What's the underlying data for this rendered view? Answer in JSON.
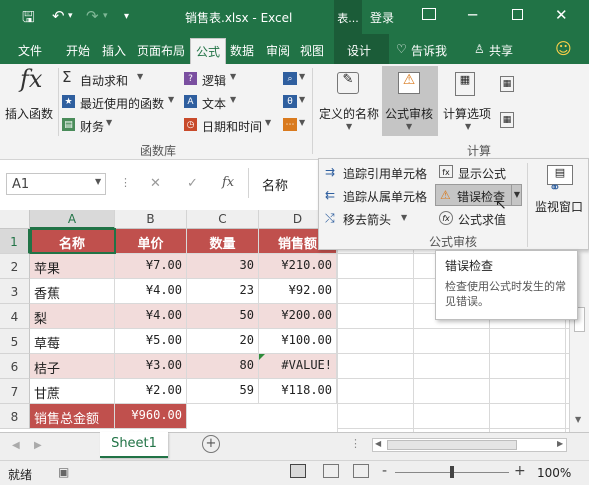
{
  "title_bar": {
    "save_icon": "save-icon",
    "undo_icon": "undo-icon",
    "redo_icon": "redo-icon",
    "customize_icon": "chevron-down-icon",
    "title": "销售表.xlsx - Excel",
    "context_tab": "表...",
    "login": "登录",
    "ribbon_display_icon": "ribbon-display-icon",
    "minimize_icon": "minimize-icon",
    "maximize_icon": "maximize-icon",
    "close_icon": "close-icon"
  },
  "tabs": {
    "file": "文件",
    "home": "开始",
    "insert": "插入",
    "page_layout": "页面布局",
    "formulas": "公式",
    "data": "数据",
    "review": "审阅",
    "view": "视图",
    "design": "设计",
    "tell_me": "告诉我",
    "share": "共享",
    "active": "公式"
  },
  "ribbon": {
    "insert_function": "插入函数",
    "autosum": "自动求和",
    "recent": "最近使用的函数",
    "financial": "财务",
    "logical": "逻辑",
    "text": "文本",
    "datetime": "日期和时间",
    "function_library": "函数库",
    "defined_names": "定义的名称",
    "formula_auditing": "公式审核",
    "calc_options": "计算选项",
    "calculation": "计算"
  },
  "formula_bar": {
    "name_box": "A1",
    "cancel": "✕",
    "enter": "✓",
    "fx": "fx",
    "content": "名称"
  },
  "audit_panel": {
    "trace_precedents": "追踪引用单元格",
    "trace_dependents": "追踪从属单元格",
    "remove_arrows": "移去箭头",
    "show_formulas": "显示公式",
    "error_checking": "错误检查",
    "evaluate_formula": "公式求值",
    "group_label": "公式审核",
    "watch_window": "监视窗口"
  },
  "tooltip": {
    "title": "错误检查",
    "body": "检查使用公式时发生的常见错误。"
  },
  "columns": [
    "A",
    "B",
    "C",
    "D"
  ],
  "row_numbers": [
    "1",
    "2",
    "3",
    "4",
    "5",
    "6",
    "7",
    "8"
  ],
  "table": {
    "headers": [
      "名称",
      "单价",
      "数量",
      "销售额"
    ],
    "rows": [
      [
        "苹果",
        "¥7.00",
        "30",
        "¥210.00"
      ],
      [
        "香蕉",
        "¥4.00",
        "23",
        "¥92.00"
      ],
      [
        "梨",
        "¥4.00",
        "50",
        "¥200.00"
      ],
      [
        "草莓",
        "¥5.00",
        "20",
        "¥100.00"
      ],
      [
        "桔子",
        "¥3.00",
        "80",
        "#VALUE!"
      ],
      [
        "甘蔗",
        "¥2.00",
        "59",
        "¥118.00"
      ]
    ],
    "total_label": "销售总金额",
    "total_value": "¥960.00"
  },
  "sheet_tabs": {
    "active": "Sheet1",
    "add_icon": "plus-icon"
  },
  "status_bar": {
    "status": "就绪",
    "zoom": "100%",
    "zoom_minus": "-",
    "zoom_plus": "+"
  },
  "colors": {
    "excel_green": "#217346",
    "header_red": "#c0504d",
    "row_pink": "#f2dcdb"
  }
}
